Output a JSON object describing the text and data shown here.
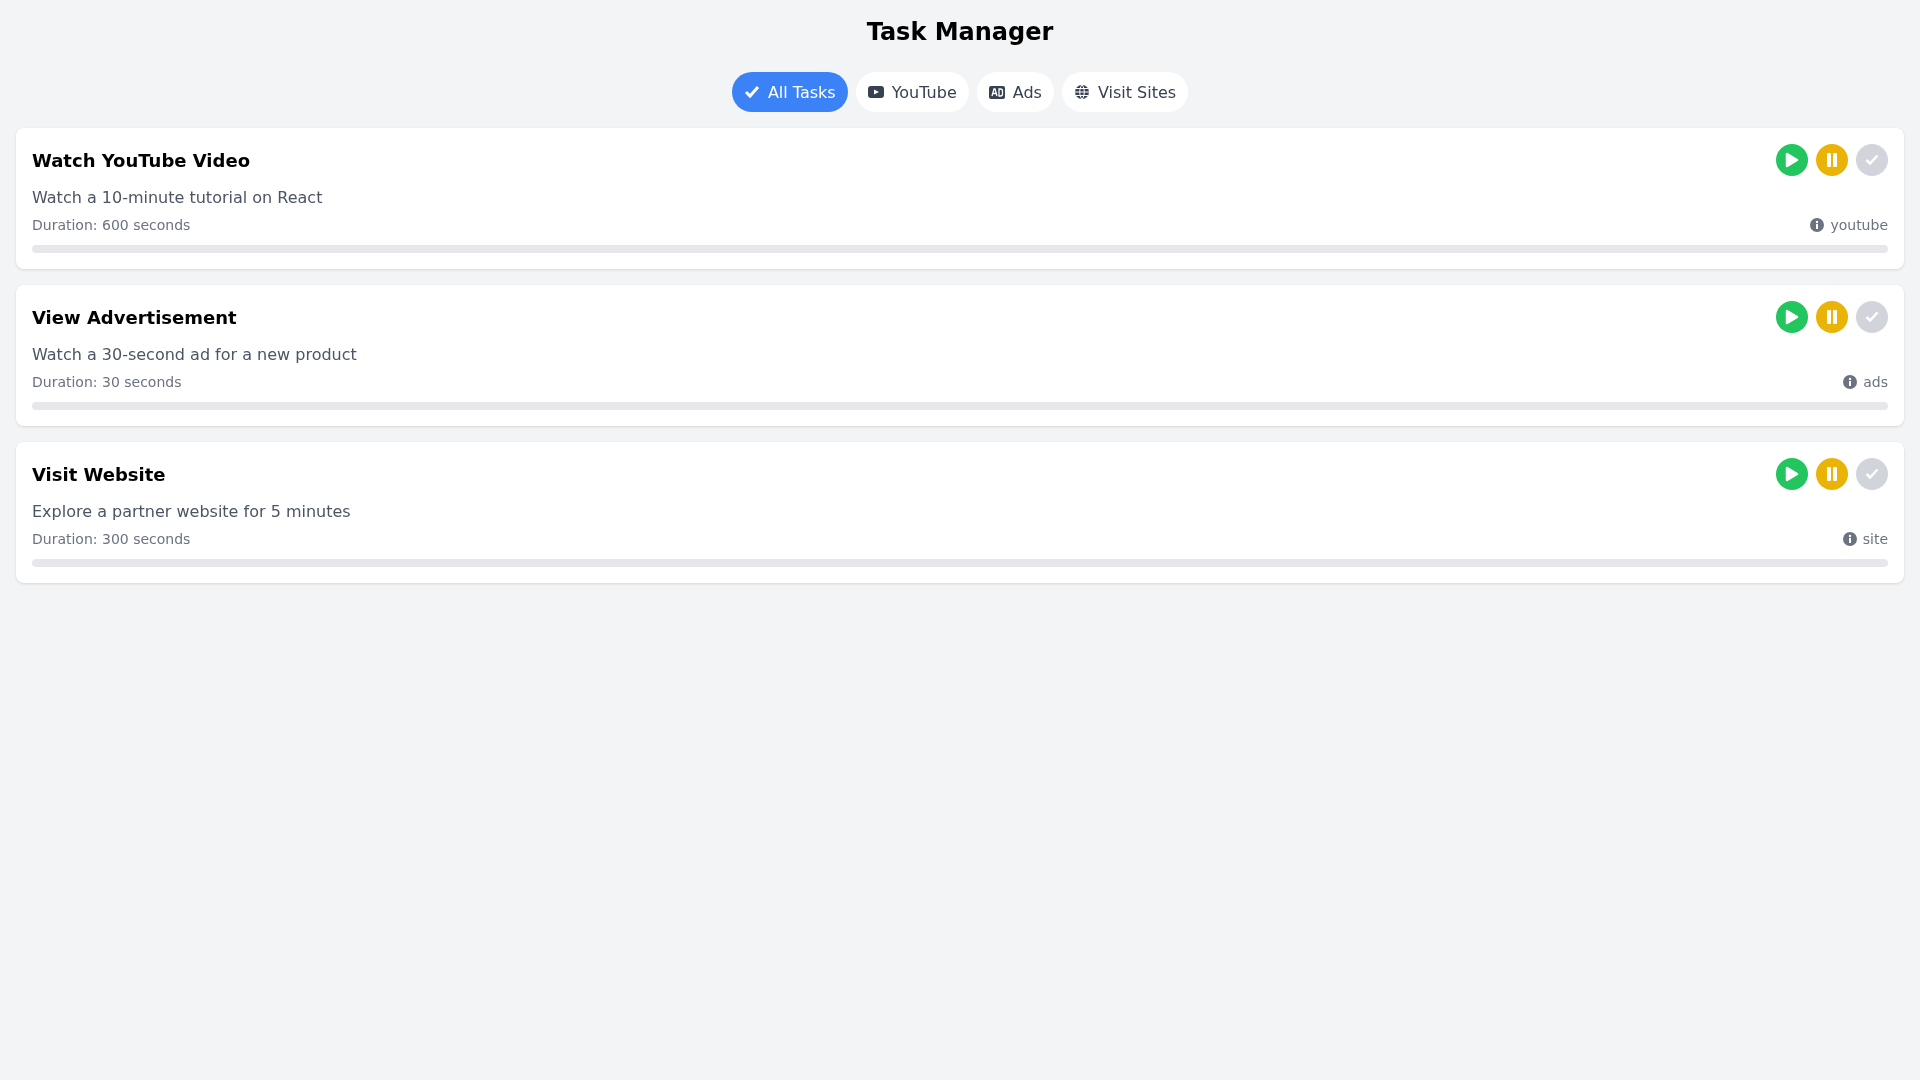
{
  "title": "Task Manager",
  "tabs": [
    {
      "label": "All Tasks",
      "kind": "check",
      "selected": true
    },
    {
      "label": "YouTube",
      "kind": "youtube",
      "selected": false
    },
    {
      "label": "Ads",
      "kind": "ad",
      "selected": false
    },
    {
      "label": "Visit Sites",
      "kind": "globe",
      "selected": false
    }
  ],
  "tasks": [
    {
      "title": "Watch YouTube Video",
      "description": "Watch a 10-minute tutorial on React",
      "duration": "Duration: 600 seconds",
      "type": "youtube",
      "complete_disabled": true
    },
    {
      "title": "View Advertisement",
      "description": "Watch a 30-second ad for a new product",
      "duration": "Duration: 30 seconds",
      "type": "ads",
      "complete_disabled": true
    },
    {
      "title": "Visit Website",
      "description": "Explore a partner website for 5 minutes",
      "duration": "Duration: 300 seconds",
      "type": "site",
      "complete_disabled": true
    }
  ]
}
